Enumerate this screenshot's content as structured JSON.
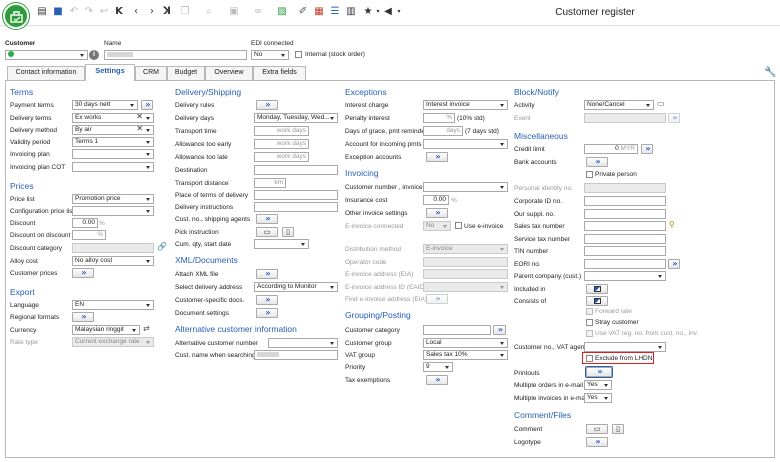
{
  "window": {
    "title": "Customer register"
  },
  "toolbar": {
    "icons": [
      "new-document-icon",
      "save-icon",
      "undo-icon",
      "redo-icon",
      "first-record-icon",
      "previous-record-icon",
      "next-record-icon",
      "last-record-icon",
      "search-icon",
      "link-icon",
      "ledger-icon",
      "grid-icon",
      "list-icon",
      "favorites-icon",
      "pin-icon"
    ]
  },
  "header": {
    "customer_label": "Customer",
    "name_label": "Name",
    "edi_label": "EDI connected",
    "edi_value": "No",
    "internal_label": "Internal (stock order)"
  },
  "tabs": [
    "Contact information",
    "Settings",
    "CRM",
    "Budget",
    "Overview",
    "Extra fields"
  ],
  "terms": {
    "title": "Terms",
    "payment_terms_label": "Payment terms",
    "payment_terms": "30 days nett",
    "delivery_terms_label": "Delivery terms",
    "delivery_terms": "Ex works",
    "delivery_method_label": "Delivery method",
    "delivery_method": "By air",
    "validity_period_label": "Validity period",
    "validity_period": "Terms 1",
    "invoicing_plan_label": "Invoicing plan",
    "invoicing_plan_cot_label": "Invoicing plan COT"
  },
  "prices": {
    "title": "Prices",
    "price_list_label": "Price list",
    "price_list": "Promotion price",
    "config_price_list_label": "Configuration price list",
    "discount_label": "Discount",
    "discount": "0.00",
    "pct": "%",
    "discount_on_discount_label": "Discount on discount",
    "discount_category_label": "Discount category",
    "alloy_cost_label": "Alloy cost",
    "alloy_cost": "No alloy cost",
    "customer_prices_label": "Customer prices"
  },
  "export": {
    "title": "Export",
    "language_label": "Language",
    "language": "EN",
    "regional_formats_label": "Regional formats",
    "currency_label": "Currency",
    "currency": "Malaysian ringgit",
    "rate_type_label": "Rate type",
    "rate_type": "Current exchange rate"
  },
  "delivery": {
    "title": "Delivery/Shipping",
    "delivery_rules_label": "Delivery rules",
    "delivery_days_label": "Delivery days",
    "delivery_days": "Monday, Tuesday, Wed...",
    "transport_time_label": "Transport time",
    "work_days": "work days",
    "allowance_early_label": "Allowance too early",
    "allowance_late_label": "Allowance too late",
    "destination_label": "Destination",
    "transport_distance_label": "Transport distance",
    "km": "km",
    "place_of_terms_label": "Place of terms of delivery",
    "delivery_instructions_label": "Delivery instructions",
    "cust_shipping_agents_label": "Cust. no., shipping agents",
    "pick_instruction_label": "Pick instruction",
    "cum_qty_label": "Cum. qty, start date"
  },
  "xml": {
    "title": "XML/Documents",
    "attach_xml_label": "Attach XML file",
    "select_delivery_address_label": "Select delivery address",
    "select_delivery_address": "According to Monitor",
    "customer_specific_docs_label": "Customer-specific docs.",
    "document_settings_label": "Document settings"
  },
  "alt_customer": {
    "title": "Alternative customer information",
    "alt_customer_number_label": "Alternative customer number",
    "cust_name_search_label": "Cust. name when searching"
  },
  "exceptions": {
    "title": "Exceptions",
    "interest_charge_label": "Interest charge",
    "interest_charge": "Interest invoice",
    "penalty_interest_label": "Penalty interest",
    "penalty_std": "(10% std)",
    "days_grace_label": "Days of grace, pmt reminder",
    "days": "days",
    "days_std": "(7 days std)",
    "account_incoming_label": "Account for incoming pmts",
    "exception_accounts_label": "Exception accounts"
  },
  "invoicing": {
    "title": "Invoicing",
    "customer_number_invoice_label": "Customer number , invoice",
    "insurance_cost_label": "Insurance cost",
    "insurance_cost": "0.00",
    "other_invoice_settings_label": "Other invoice settings",
    "e_invoice_connected_label": "E-invoice connected",
    "e_invoice_connected": "No",
    "use_e_invoice_label": "Use e-invoice",
    "distribution_method_label": "Distribution method",
    "distribution_method": "E-invoice",
    "operator_code_label": "Operator code",
    "e_invoice_address_label": "E-invoice address (EIA)",
    "e_invoice_address_id_label": "E-invoice address ID (EAID)",
    "find_e_invoice_label": "Find e-invoice address (EIA)"
  },
  "grouping": {
    "title": "Grouping/Posting",
    "customer_category_label": "Customer category",
    "customer_group_label": "Customer group",
    "customer_group": "Local",
    "vat_group_label": "VAT group",
    "vat_group": "Sales tax 10%",
    "priority_label": "Priority",
    "priority": "9",
    "tax_exemptions_label": "Tax exemptions"
  },
  "block": {
    "title": "Block/Notify",
    "activity_label": "Activity",
    "activity": "None/Cancel",
    "event_label": "Event"
  },
  "misc": {
    "title": "Miscellaneous",
    "credit_limit_label": "Credit limit",
    "credit_limit": "0",
    "currency_code": "MYR",
    "bank_accounts_label": "Bank accounts",
    "private_person_label": "Private person",
    "personal_identity_label": "Personal identity no.",
    "corporate_id_label": "Corporate ID no.",
    "our_suppl_label": "Our suppl. no.",
    "sales_tax_number_label": "Sales tax number",
    "service_tax_number_label": "Service tax number",
    "tin_number_label": "TIN number",
    "eori_label": "EORI no.",
    "parent_company_label": "Parent company (cust.)",
    "included_in_label": "Included in",
    "consists_of_label": "Consists of",
    "forward_rate_label": "Forward rate",
    "stray_customer_label": "Stray customer",
    "use_vat_reg_label": "Use VAT reg. no. from cust. no., inv.",
    "customer_no_vat_agent_label": "Customer no., VAT agent",
    "exclude_lhdn_label": "Exclude from LHDN",
    "printouts_label": "Printouts",
    "multiple_orders_label": "Multiple orders in e-mail",
    "multiple_orders": "Yes",
    "multiple_invoices_label": "Multiple invoices in e-mail",
    "multiple_invoices": "Yes"
  },
  "comment": {
    "title": "Comment/Files",
    "comment_label": "Comment",
    "logotype_label": "Logotype"
  },
  "colors": {
    "accent": "#2860b4",
    "highlight": "#e02020",
    "status_green": "#22b24c"
  }
}
